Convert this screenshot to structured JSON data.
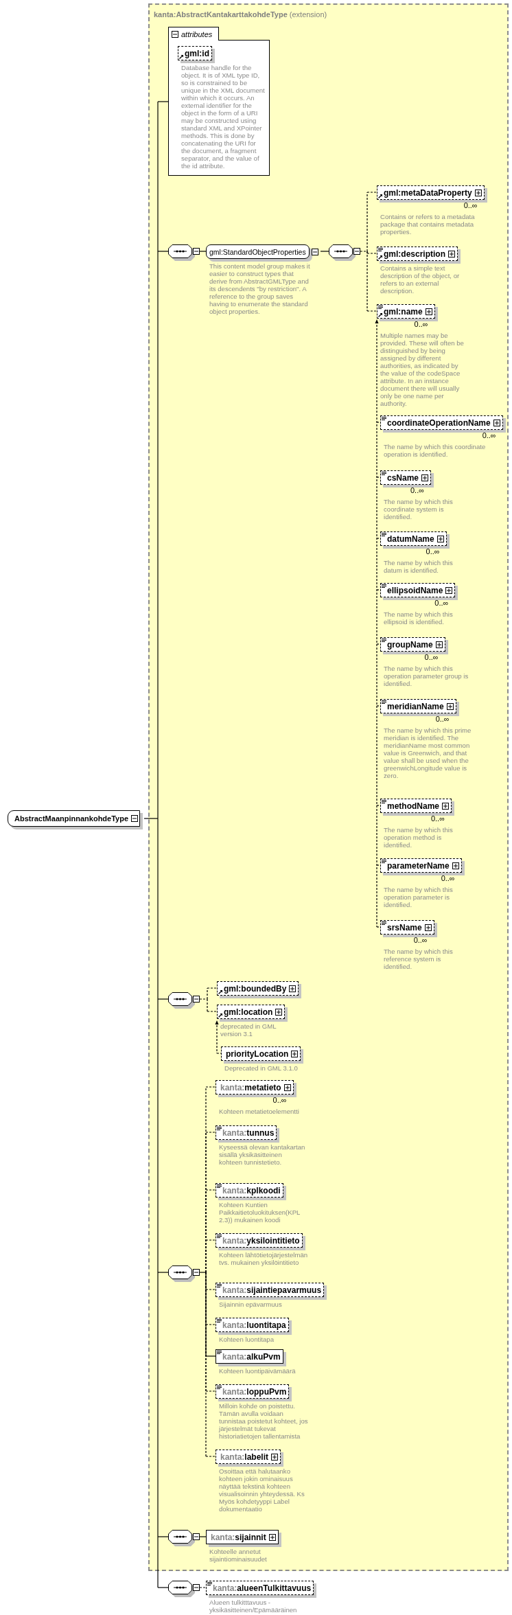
{
  "root": {
    "name": "AbstractMaanpinnankohdeType",
    "expanded": true
  },
  "extension": {
    "base": "kanta:AbstractKantakarttakohdeType",
    "note": "(extension)",
    "attributes": {
      "title": "attributes",
      "expanded": true,
      "items": [
        {
          "name": "gml:id",
          "optional": true,
          "reference": true,
          "simple_content": false,
          "expandable": false,
          "doc": "Database handle for the object. It is of XML type ID, so is constrained to be unique in the XML document within which it occurs. An external identifier for the object in the form of a URI may be constructed using standard XML and XPointer methods. This is done by concatenating the URI for the document, a fragment separator, and the value of the id attribute."
        }
      ]
    },
    "sequences": [
      {
        "expanded": true,
        "group": {
          "name": "gml:StandardObjectProperties",
          "expanded": true,
          "doc": "This content model group makes it easier to construct types that derive from AbstractGMLType and its descendents \"by restriction\". A reference to the group saves having to enumerate the standard object properties.",
          "sequence": {
            "expanded": true,
            "elements": [
              {
                "name": "gml:metaDataProperty",
                "optional": true,
                "reference": true,
                "simple_content": false,
                "expandable": true,
                "multiplicity": "0..∞",
                "doc": "Contains or refers to a metadata package that contains metadata properties."
              },
              {
                "name": "gml:description",
                "optional": true,
                "reference": true,
                "simple_content": true,
                "expandable": true,
                "doc": "Contains a simple text description of the object, or refers to an external description."
              },
              {
                "name": "gml:name",
                "optional": true,
                "reference": true,
                "simple_content": true,
                "expandable": true,
                "multiplicity": "0..∞",
                "doc": "Multiple names may be provided. These will often be distinguished by being assigned by different authorities, as indicated by the value of the codeSpace attribute. In an instance document there will usually only be one name per authority.",
                "substitutes": [
                  {
                    "name": "coordinateOperationName",
                    "optional": true,
                    "reference": false,
                    "simple_content": true,
                    "expandable": true,
                    "multiplicity": "0..∞",
                    "doc": "The name by which this coordinate operation is identified."
                  },
                  {
                    "name": "csName",
                    "optional": true,
                    "reference": false,
                    "simple_content": true,
                    "expandable": true,
                    "multiplicity": "0..∞",
                    "doc": "The name by which this coordinate system is identified."
                  },
                  {
                    "name": "datumName",
                    "optional": true,
                    "reference": false,
                    "simple_content": true,
                    "expandable": true,
                    "multiplicity": "0..∞",
                    "doc": "The name by which this datum is identified."
                  },
                  {
                    "name": "ellipsoidName",
                    "optional": true,
                    "reference": false,
                    "simple_content": true,
                    "expandable": true,
                    "multiplicity": "0..∞",
                    "doc": "The name by which this ellipsoid is identified."
                  },
                  {
                    "name": "groupName",
                    "optional": true,
                    "reference": false,
                    "simple_content": true,
                    "expandable": true,
                    "multiplicity": "0..∞",
                    "doc": "The name by which this operation parameter group is identified."
                  },
                  {
                    "name": "meridianName",
                    "optional": true,
                    "reference": false,
                    "simple_content": true,
                    "expandable": true,
                    "multiplicity": "0..∞",
                    "doc": "The name by which this prime meridian is identified. The meridianName most common value is Greenwich, and that value shall be used when the greenwichLongitude value is zero."
                  },
                  {
                    "name": "methodName",
                    "optional": true,
                    "reference": false,
                    "simple_content": true,
                    "expandable": true,
                    "multiplicity": "0..∞",
                    "doc": "The name by which this operation method is identified."
                  },
                  {
                    "name": "parameterName",
                    "optional": true,
                    "reference": false,
                    "simple_content": true,
                    "expandable": true,
                    "multiplicity": "0..∞",
                    "doc": "The name by which this operation parameter is identified."
                  },
                  {
                    "name": "srsName",
                    "optional": true,
                    "reference": false,
                    "simple_content": true,
                    "expandable": true,
                    "multiplicity": "0..∞",
                    "doc": "The name by which this reference system is identified."
                  }
                ]
              }
            ]
          }
        }
      },
      {
        "expanded": true,
        "elements": [
          {
            "name": "gml:boundedBy",
            "optional": true,
            "reference": true,
            "simple_content": false,
            "expandable": true
          },
          {
            "name": "gml:location",
            "optional": true,
            "reference": true,
            "simple_content": false,
            "expandable": true,
            "doc": "deprecated in GML version 3.1",
            "substitutes": [
              {
                "name": "priorityLocation",
                "optional": true,
                "reference": false,
                "simple_content": false,
                "expandable": true,
                "doc": "Deprecated in GML 3.1.0"
              }
            ]
          }
        ]
      },
      {
        "expanded": true,
        "elements": [
          {
            "prefix": "kanta:",
            "name": "metatieto",
            "optional": true,
            "reference": false,
            "simple_content": false,
            "expandable": true,
            "multiplicity": "0..∞",
            "doc": "Kohteen metatietoelementti"
          },
          {
            "prefix": "kanta:",
            "name": "tunnus",
            "optional": true,
            "reference": false,
            "simple_content": true,
            "expandable": false,
            "doc": "Kyseessä olevan kantakartan sisällä yksikäsitteinen kohteen tunnistetieto."
          },
          {
            "prefix": "kanta:",
            "name": "kplkoodi",
            "optional": true,
            "reference": false,
            "simple_content": true,
            "expandable": false,
            "doc": "Kohteen Kuntien Paikkaitietoluokituksen(KPL 2.3)) mukainen koodi"
          },
          {
            "prefix": "kanta:",
            "name": "yksilointitieto",
            "optional": true,
            "reference": false,
            "simple_content": true,
            "expandable": false,
            "doc": "Kohteen lähtötietojärjestelmän tvs. mukainen yksilöintitieto"
          },
          {
            "prefix": "kanta:",
            "name": "sijaintiepavarmuus",
            "optional": true,
            "reference": false,
            "simple_content": true,
            "expandable": false,
            "doc": "Sijainnin epävarmuus"
          },
          {
            "prefix": "kanta:",
            "name": "luontitapa",
            "optional": true,
            "reference": false,
            "simple_content": true,
            "expandable": false,
            "doc": "Kohteen luontitapa"
          },
          {
            "prefix": "kanta:",
            "name": "alkuPvm",
            "optional": false,
            "reference": false,
            "simple_content": true,
            "expandable": false,
            "doc": "Kohteen luontipäivämäärä"
          },
          {
            "prefix": "kanta:",
            "name": "loppuPvm",
            "optional": true,
            "reference": false,
            "simple_content": true,
            "expandable": false,
            "doc": "Milloin kohde on poistettu. Tämän avulla voidaan tunnistaa poistetut kohteet, jos järjestelmät tukevat historiatietojen tallentamista"
          },
          {
            "prefix": "kanta:",
            "name": "labelit",
            "optional": true,
            "reference": false,
            "simple_content": false,
            "expandable": true,
            "doc": "Osoittaa että halutaanko kohteen jokin ominaisuus näyttää tekstinä kohteen visualisoinnin yhteydessä. Ks Myös kohdetyyppi Label dokumentaatio"
          }
        ]
      },
      {
        "expanded": true,
        "elements": [
          {
            "prefix": "kanta:",
            "name": "sijainnit",
            "optional": false,
            "reference": false,
            "simple_content": false,
            "expandable": true,
            "doc": "Kohteelle annetut sijaintiominaisuudet"
          }
        ]
      }
    ]
  },
  "sequences": [
    {
      "expanded": true,
      "elements": [
        {
          "prefix": "kanta:",
          "name": "alueenTulkittavuus",
          "optional": true,
          "reference": false,
          "simple_content": true,
          "expandable": false,
          "doc": "Alueen tulkitttavuus - yksikäsitteinen/Epämääräinen"
        }
      ]
    }
  ]
}
